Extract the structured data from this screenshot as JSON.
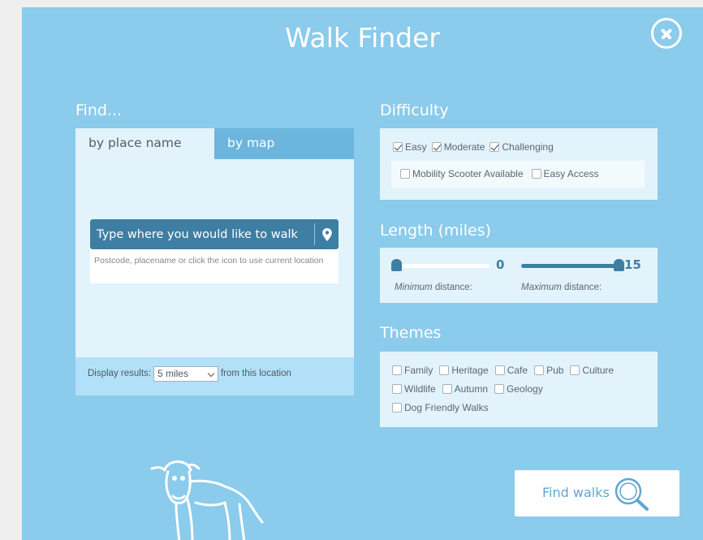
{
  "header": {
    "title": "Walk Finder",
    "close_icon": "close-circle-icon"
  },
  "find": {
    "heading": "Find...",
    "tabs": [
      {
        "label": "by place name",
        "active": true
      },
      {
        "label": "by map",
        "active": false
      }
    ],
    "search": {
      "placeholder": "Type where you would like to walk",
      "value": "",
      "location_icon": "map-pin-icon",
      "help_text": "Postcode, placename or click the icon to use current location"
    },
    "display_results": {
      "prefix": "Display results:",
      "selected": "5 miles",
      "suffix": "from this location"
    }
  },
  "difficulty": {
    "heading": "Difficulty",
    "options": [
      {
        "label": "Easy",
        "checked": true
      },
      {
        "label": "Moderate",
        "checked": true
      },
      {
        "label": "Challenging",
        "checked": true
      }
    ],
    "access_options": [
      {
        "label": "Mobility Scooter Available",
        "checked": false
      },
      {
        "label": "Easy Access",
        "checked": false
      }
    ]
  },
  "length": {
    "heading": "Length (miles)",
    "min": {
      "value": "0",
      "caption_em": "Minimum",
      "caption_rest": " distance:"
    },
    "max": {
      "value": "15",
      "caption_em": "Maximum",
      "caption_rest": " distance:"
    }
  },
  "themes": {
    "heading": "Themes",
    "rows": [
      [
        {
          "label": "Family",
          "checked": false
        },
        {
          "label": "Heritage",
          "checked": false
        },
        {
          "label": "Cafe",
          "checked": false
        },
        {
          "label": "Pub",
          "checked": false
        },
        {
          "label": "Culture",
          "checked": false
        }
      ],
      [
        {
          "label": "Wildlife",
          "checked": false
        },
        {
          "label": "Autumn",
          "checked": false
        },
        {
          "label": "Geology",
          "checked": false
        }
      ],
      [
        {
          "label": "Dog Friendly Walks",
          "checked": false
        }
      ]
    ]
  },
  "actions": {
    "find_walks_label": "Find walks",
    "find_walks_icon": "magnifier-icon"
  },
  "decoration": {
    "illustration": "cow-illustration"
  },
  "colors": {
    "panel_bg": "#8bcbec",
    "card_bg": "#e3f3fc",
    "accent_dark": "#3f7ea3",
    "tab_inactive": "#6cb5dd"
  }
}
